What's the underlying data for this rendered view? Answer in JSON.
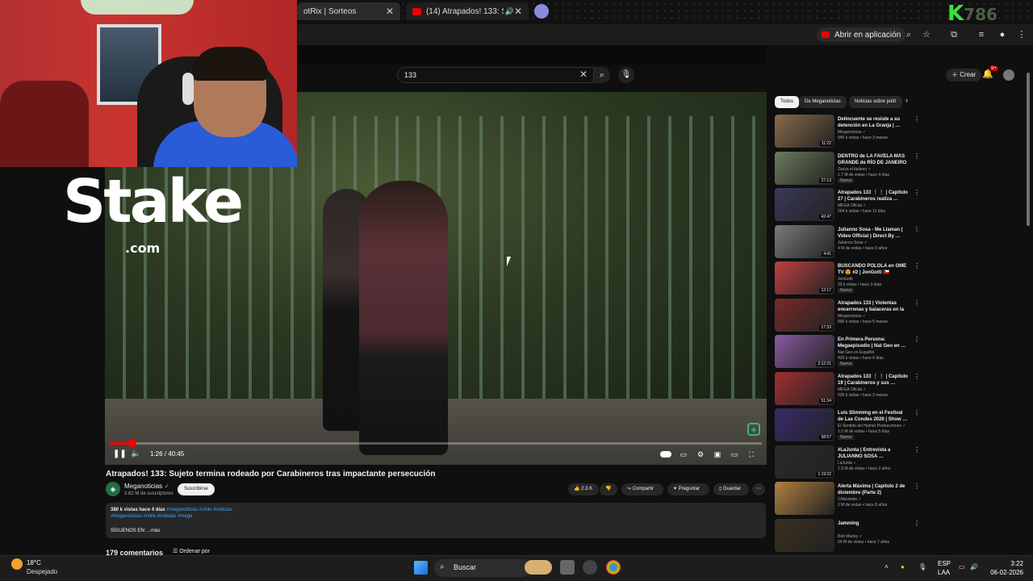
{
  "browser": {
    "tabs": [
      {
        "label": "otRix | Sorteos"
      },
      {
        "label": "(14) Atrapados! 133: Sujet…"
      }
    ],
    "open_in_app": "Abrir en aplicación"
  },
  "overlay": {
    "stake_logo": "Stake",
    "stake_com": ".com",
    "streamer_logo": "K",
    "streamer_logo_tail": "786"
  },
  "youtube": {
    "search": {
      "value": "133"
    },
    "create_label": "Crear",
    "notification_count": "9+"
  },
  "player": {
    "time": "1:26 / 40:45",
    "progress": 0.035
  },
  "video": {
    "title": "Atrapados! 133: Sujeto termina rodeado por Carabineros tras impactante persecución",
    "channel_name": "Meganoticias",
    "channel_subs": "3.82 M de suscriptores",
    "subscribe": "Suscribirse",
    "likes": "2.3 K",
    "share": "Compartir",
    "ask": "Preguntar",
    "save": "Guardar",
    "desc_views": "380 k vistas  hace 4 días",
    "desc_tags1": "#meganoticias #chile #noticias",
    "desc_tags2": "#meganoticias #chile #noticias #mega",
    "desc_line3": "SÍGUENOS EN:  ...más",
    "comments": "179 comentarios",
    "sort": "Ordenar por"
  },
  "sidebar": {
    "chips": [
      "Todos",
      "De Meganoticias",
      "Noticias sobre polít"
    ],
    "recs": [
      {
        "title": "Delincuente se resiste a su detención en La Granja | …",
        "channel": "Meganoticias ✓",
        "meta": "945 k vistas • hace 3 meses",
        "badge": "",
        "duration": "11:22",
        "color": "#8a6a4a"
      },
      {
        "title": "DENTRO de LA FAVELA MÁS GRANDE de RÍO DE JANEIRO …",
        "channel": "Zazza el italiano ✓",
        "meta": "1.7 M de vistas • hace 4 días",
        "badge": "Nuevo",
        "duration": "27:13",
        "color": "#6b7a5a"
      },
      {
        "title": "Atrapados 133 ❗❗ | Capítulo 27 | Carabineros realiza …",
        "channel": "MEGA Oficial ✓",
        "meta": "204 k vistas • hace 11 días",
        "badge": "",
        "duration": "42:47",
        "color": "#3a3a5a"
      },
      {
        "title": "Julianno Sosa - Me Llaman ( Video Official ) Direct By …",
        "channel": "Julianno Sosa ✓",
        "meta": "4 M de vistas • hace 5 años",
        "badge": "",
        "duration": "4:41",
        "color": "#7a7a7a"
      },
      {
        "title": "BUSCANDO POLOLA en OME TV 😍 #2 | JonGotti 🇨🇱",
        "channel": "JonGotti",
        "meta": "33 k vistas • hace 3 días",
        "badge": "Nuevo",
        "duration": "12:17",
        "color": "#c04040"
      },
      {
        "title": "Atrapados 133 | Violentas encerronas y balaceras en la …",
        "channel": "Meganoticias ✓",
        "meta": "896 k vistas • hace 5 meses",
        "badge": "",
        "duration": "17:33",
        "color": "#7a2a2a"
      },
      {
        "title": "En Primera Persona: Megaepisodio | Nat Geo en …",
        "channel": "Nat Geo en Español",
        "meta": "429 k vistas • hace 6 días",
        "badge": "Nuevo",
        "duration": "2:12:21",
        "color": "#8a5aa0"
      },
      {
        "title": "Atrapados 133 ❗❗ | Capítulo 19 | Carabineros y sus …",
        "channel": "MEGA Oficial ✓",
        "meta": "539 k vistas • hace 2 meses",
        "badge": "",
        "duration": "51:34",
        "color": "#a03030"
      },
      {
        "title": "Luis Slimming en el Festival de Las Condes 2026 | Show …",
        "channel": "El Sentido del Humor Producciones ✓",
        "meta": "1.5 M de vistas • hace 5 días",
        "badge": "Nuevo",
        "duration": "58:57",
        "color": "#3a2a6a"
      },
      {
        "title": "#LaJunta | Entrevista a JULIANNO SOSA …",
        "channel": "LaJunta ✓",
        "meta": "1.9 M de vistas • hace 2 años",
        "badge": "",
        "duration": "1:19:22",
        "color": "#2a2a2a"
      },
      {
        "title": "Alerta Máxima | Capítulo 2 de diciembre (Parte 2)",
        "channel": "Chilevisión ✓",
        "meta": "2 M de vistas • hace 8 años",
        "badge": "",
        "duration": "",
        "color": "#b08040"
      },
      {
        "title": "Jamming",
        "channel": "Bob Marley ✓",
        "meta": "24 M de vistas • hace 7 años",
        "badge": "",
        "duration": "",
        "color": "#3a3020"
      }
    ]
  },
  "taskbar": {
    "temp": "18°C",
    "weather": "Despejado",
    "search": "Buscar",
    "lang1": "ESP",
    "lang2": "LAA",
    "time": "3:22",
    "date": "06-02-2026"
  }
}
